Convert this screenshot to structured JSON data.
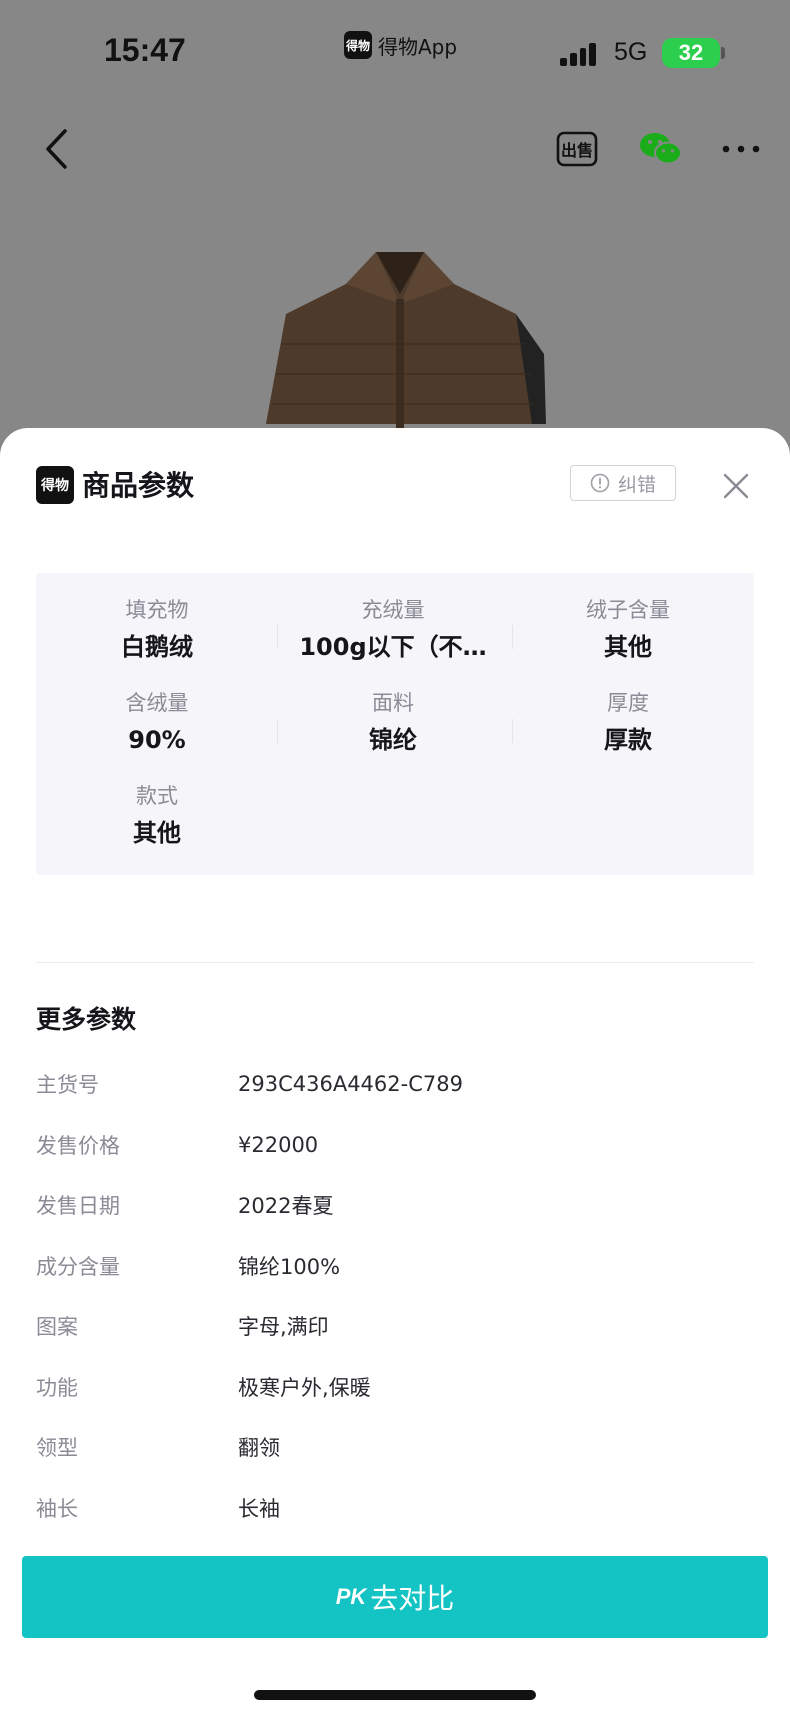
{
  "status_bar": {
    "time": "15:47",
    "app_logo_text": "得物",
    "app_name": "得物App",
    "network": "5G",
    "battery": "32"
  },
  "nav": {
    "back_icon": "chevron-left-icon",
    "sell_icon": "sell-icon",
    "sell_icon_text": "出售",
    "wechat_icon": "wechat-icon",
    "more_icon": "more-dots-icon"
  },
  "sheet": {
    "logo_text": "得物",
    "title": "商品参数",
    "report_label": "纠错",
    "report_icon": "alert-circle-icon",
    "close_icon": "close-icon"
  },
  "key_params": [
    {
      "label": "填充物",
      "value": "白鹅绒"
    },
    {
      "label": "充绒量",
      "value": "100g以下（不…"
    },
    {
      "label": "绒子含量",
      "value": "其他"
    },
    {
      "label": "含绒量",
      "value": "90%"
    },
    {
      "label": "面料",
      "value": "锦纶"
    },
    {
      "label": "厚度",
      "value": "厚款"
    },
    {
      "label": "款式",
      "value": "其他"
    }
  ],
  "more_params": {
    "title": "更多参数",
    "rows": [
      {
        "label": "主货号",
        "value": "293C436A4462-C789"
      },
      {
        "label": "发售价格",
        "value": "¥22000"
      },
      {
        "label": "发售日期",
        "value": "2022春夏"
      },
      {
        "label": "成分含量",
        "value": "锦纶100%"
      },
      {
        "label": "图案",
        "value": "字母,满印"
      },
      {
        "label": "功能",
        "value": "极寒户外,保暖"
      },
      {
        "label": "领型",
        "value": "翻领"
      },
      {
        "label": "袖长",
        "value": "长袖"
      }
    ]
  },
  "pk_button": {
    "badge": "PK",
    "label": "去对比"
  },
  "colors": {
    "accent": "#14c3c3",
    "backdrop": "#878787",
    "panel": "#f6f6fa"
  }
}
